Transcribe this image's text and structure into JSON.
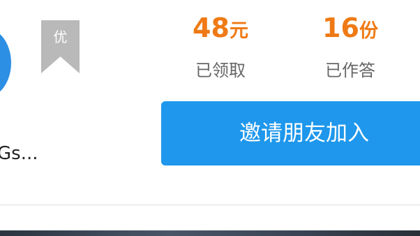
{
  "user": {
    "name": "Gs..."
  },
  "badge": {
    "label": "优"
  },
  "stats": {
    "claimed": {
      "value": "48",
      "unit": "元",
      "label": "已领取"
    },
    "answered": {
      "value": "16",
      "unit": "份",
      "label": "已作答"
    }
  },
  "actions": {
    "invite_label": "邀请朋友加入"
  },
  "colors": {
    "accent_orange": "#ef7a15",
    "primary_blue": "#1e97ec",
    "avatar_blue": "#2d8fe4",
    "badge_gray": "#b9b9b9"
  }
}
